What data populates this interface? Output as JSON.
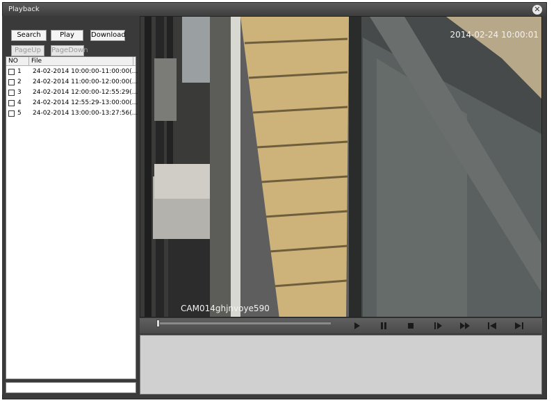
{
  "window": {
    "title": "Playback",
    "close_icon": "close-icon"
  },
  "left_panel": {
    "buttons": {
      "search": "Search",
      "play": "Play",
      "download": "Download",
      "page_up": "PageUp",
      "page_down": "PageDown"
    },
    "list": {
      "columns": [
        "NO",
        "File"
      ],
      "rows": [
        {
          "no": "1",
          "file": "24-02-2014 10:00:00-11:00:00(..."
        },
        {
          "no": "2",
          "file": "24-02-2014 11:00:00-12:00:00(..."
        },
        {
          "no": "3",
          "file": "24-02-2014 12:00:00-12:55:29(..."
        },
        {
          "no": "4",
          "file": "24-02-2014 12:55:29-13:00:00(..."
        },
        {
          "no": "5",
          "file": "24-02-2014 13:00:00-13:27:56(..."
        }
      ]
    }
  },
  "video": {
    "timestamp": "2014-02-24 10:00:01",
    "camera_name": "CAM014ghjnvoye590"
  },
  "controls": {
    "progress": 0.0,
    "icons": [
      "play-icon",
      "pause-icon",
      "stop-icon",
      "step-forward-icon",
      "fast-forward-icon",
      "previous-icon",
      "next-icon"
    ]
  }
}
